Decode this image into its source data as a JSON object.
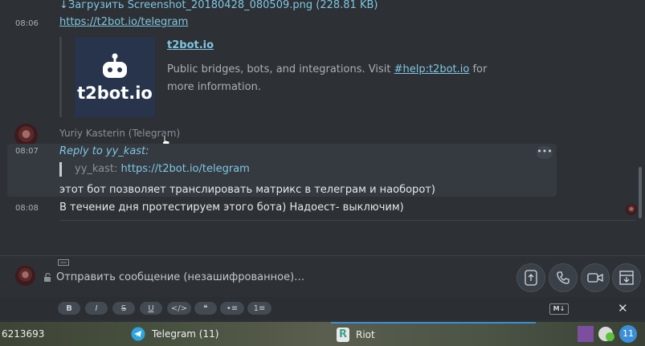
{
  "messages": {
    "download_link": "↓Загрузить Screenshot_20180428_080509.png (228.81 KB)",
    "msg1": {
      "time": "08:06",
      "link": "https://t2bot.io/telegram",
      "preview": {
        "thumb_text": "t2bot.io",
        "title": "t2bot.io",
        "desc_pre": "Public bridges, bots, and integrations. Visit ",
        "desc_link": "#help:t2bot.io",
        "desc_post": " for",
        "desc_line2": "more information."
      }
    },
    "sender": "Yuriy Kasterin (Telegram)",
    "msg2": {
      "time": "08:07",
      "reply_label": "Reply to yy_kast:",
      "quote_user": "yy_kast:",
      "quote_link": "https://t2bot.io/telegram",
      "text": "этот бот позволяет транслировать матрикс в телеграм и наоборот)"
    },
    "msg3": {
      "time": "08:08",
      "text": "В течение дня протестируем этого бота) Надоест- выключим)"
    }
  },
  "composer": {
    "placeholder": "Отправить сообщение (незашифрованное)…",
    "format": {
      "bold": "B",
      "italic": "I",
      "strike": "S",
      "underline": "U",
      "code": "</>",
      "quote": "❝",
      "bullet": "•≡",
      "numbered": "1≡"
    },
    "markdown_badge": "M↓"
  },
  "taskbar": {
    "left_text": "6213693",
    "telegram": "Telegram (11)",
    "riot": "Riot",
    "badge": "11"
  },
  "colors": {
    "accent_link": "#7fc7e3",
    "telegram_blue": "#2ca5e0",
    "badge_blue": "#3b8fd6"
  }
}
